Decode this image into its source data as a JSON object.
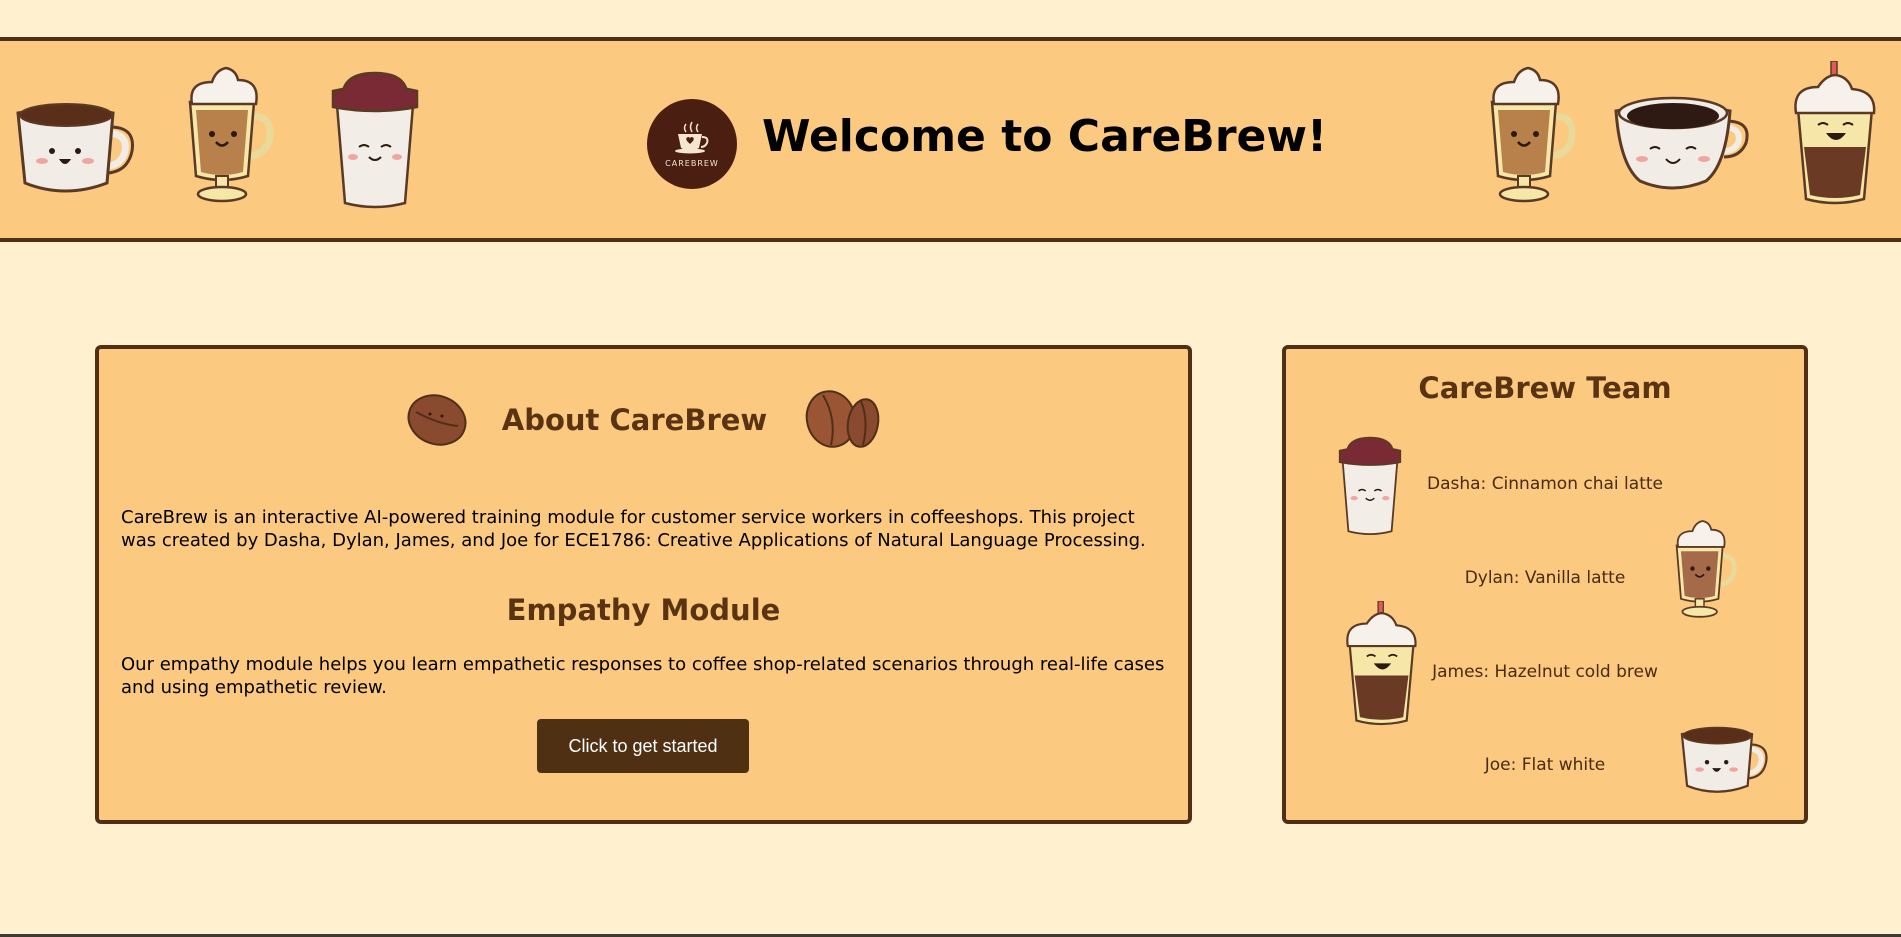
{
  "header": {
    "logo_text": "CAREBREW",
    "title": "Welcome to CareBrew!",
    "mascots": [
      "mug-mascot-icon",
      "whipped-latte-glass-icon",
      "takeaway-cup-icon",
      "whipped-latte-glass-icon",
      "coffee-cup-icon",
      "iced-drink-icon"
    ]
  },
  "about": {
    "title": "About CareBrew",
    "description": "CareBrew is an interactive AI-powered training module for customer service workers in coffeeshops. This project was created by Dasha, Dylan, James, and Joe for ECE1786: Creative Applications of Natural Language Processing.",
    "module_title": "Empathy Module",
    "module_description": "Our empathy module helps you learn empathetic responses to coffee shop-related scenarios through real-life cases and using empathetic review.",
    "cta_label": "Click to get started"
  },
  "team": {
    "title": "CareBrew Team",
    "members": [
      {
        "text": "Dasha: Cinnamon chai latte",
        "icon": "takeaway-cup-icon"
      },
      {
        "text": "Dylan: Vanilla latte",
        "icon": "whipped-latte-glass-icon"
      },
      {
        "text": "James: Hazelnut cold brew",
        "icon": "iced-drink-icon"
      },
      {
        "text": "Joe: Flat white",
        "icon": "mug-mascot-icon"
      }
    ]
  },
  "colors": {
    "page_bg": "#fff0cf",
    "panel_bg": "#fbc97f",
    "border": "#4f3017",
    "heading": "#5a3313",
    "button": "#4f3013"
  }
}
